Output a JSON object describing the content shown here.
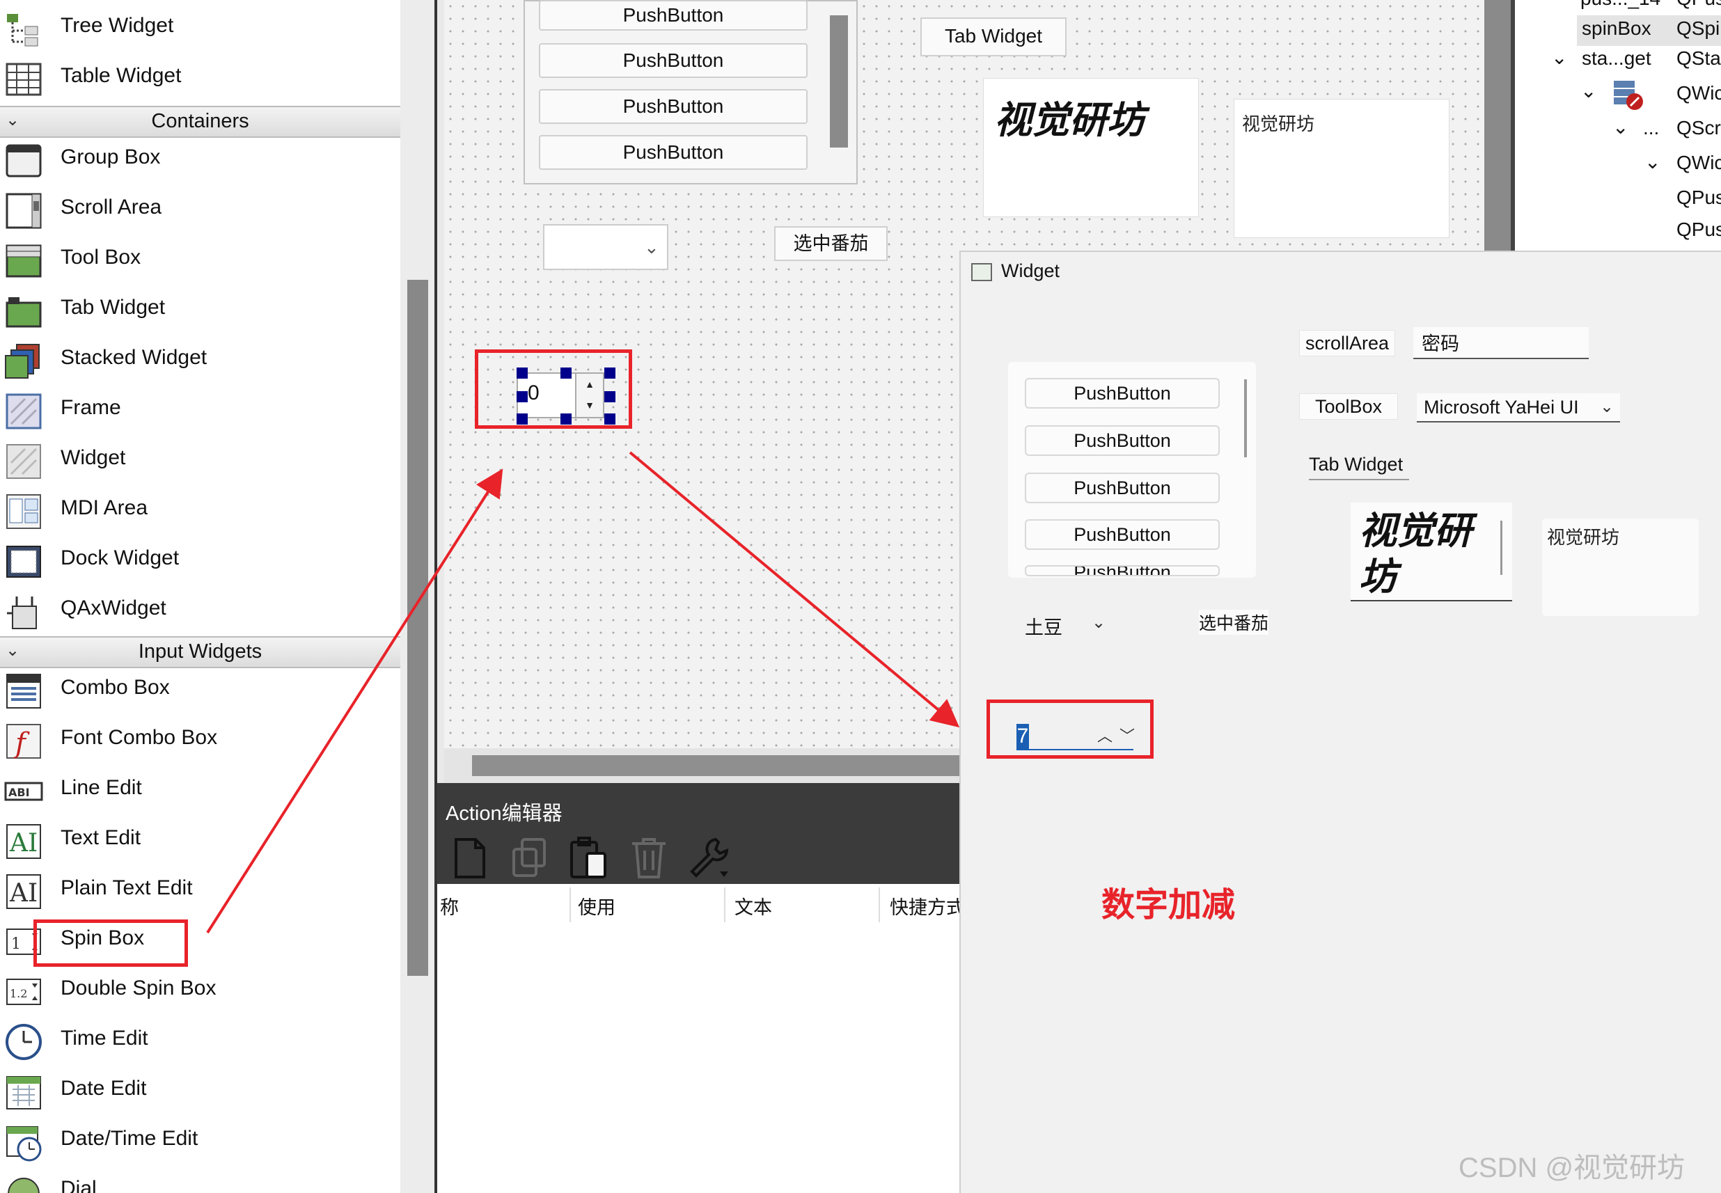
{
  "widget_box": {
    "items_top": [
      {
        "label": "Tree Widget",
        "icon": "tree-widget-icon"
      },
      {
        "label": "Table Widget",
        "icon": "table-widget-icon"
      }
    ],
    "cat_containers": "Containers",
    "containers": [
      {
        "label": "Group Box",
        "icon": "group-box-icon"
      },
      {
        "label": "Scroll Area",
        "icon": "scroll-area-icon"
      },
      {
        "label": "Tool Box",
        "icon": "tool-box-icon"
      },
      {
        "label": "Tab Widget",
        "icon": "tab-widget-icon"
      },
      {
        "label": "Stacked Widget",
        "icon": "stacked-widget-icon"
      },
      {
        "label": "Frame",
        "icon": "frame-icon"
      },
      {
        "label": "Widget",
        "icon": "widget-icon"
      },
      {
        "label": "MDI Area",
        "icon": "mdi-area-icon"
      },
      {
        "label": "Dock Widget",
        "icon": "dock-widget-icon"
      },
      {
        "label": "QAxWidget",
        "icon": "qaxwidget-icon"
      }
    ],
    "cat_input": "Input Widgets",
    "input": [
      {
        "label": "Combo Box",
        "icon": "combo-box-icon"
      },
      {
        "label": "Font Combo Box",
        "icon": "font-combo-box-icon"
      },
      {
        "label": "Line Edit",
        "icon": "line-edit-icon"
      },
      {
        "label": "Text Edit",
        "icon": "text-edit-icon"
      },
      {
        "label": "Plain Text Edit",
        "icon": "plain-text-edit-icon"
      },
      {
        "label": "Spin Box",
        "icon": "spin-box-icon"
      },
      {
        "label": "Double Spin Box",
        "icon": "double-spin-box-icon"
      },
      {
        "label": "Time Edit",
        "icon": "time-edit-icon"
      },
      {
        "label": "Date Edit",
        "icon": "date-edit-icon"
      },
      {
        "label": "Date/Time Edit",
        "icon": "date-time-edit-icon"
      },
      {
        "label": "Dial",
        "icon": "dial-icon"
      }
    ]
  },
  "designer": {
    "push_button": "PushButton",
    "tab_widget": "Tab Widget",
    "logo_text": "视觉研坊",
    "text_edit": "视觉研坊",
    "button_tomato": "选中番茄",
    "spin_value": "0"
  },
  "action_editor": {
    "title": "Action编辑器",
    "columns": [
      "称",
      "使用",
      "文本",
      "快捷方式"
    ],
    "icons": [
      "new-action-icon",
      "copy-icon",
      "paste-icon",
      "delete-icon",
      "settings-wrench-icon"
    ]
  },
  "inspector": {
    "rows": [
      {
        "name": "pus..._14",
        "class": "QPus"
      },
      {
        "name": "spinBox",
        "class": "QSpi"
      },
      {
        "name": "sta...get",
        "class": "QSta"
      },
      {
        "name": "",
        "class": "QWic"
      },
      {
        "name": "...",
        "class": "QScr"
      },
      {
        "name": "",
        "class": "QWic"
      },
      {
        "name": "",
        "class": "QPus"
      },
      {
        "name": "",
        "class": "QPus"
      }
    ]
  },
  "preview": {
    "title": "Widget",
    "push_button": "PushButton",
    "push_button_partial": "PushButton",
    "scroll_area_label": "scrollArea",
    "password_value": "密码",
    "toolbox_label": "ToolBox",
    "font_value": "Microsoft YaHei UI",
    "tab_widget_label": "Tab Widget",
    "logo_text": "视觉研坊",
    "text_edit": "视觉研坊",
    "combo_value": "土豆",
    "tomato_label": "选中番茄",
    "spin_value": "7"
  },
  "annotation": "数字加减",
  "watermark": "CSDN @视觉研坊",
  "colors": {
    "highlight": "#e8232a",
    "selection": "#1a5fb4",
    "handle": "#00008b"
  }
}
